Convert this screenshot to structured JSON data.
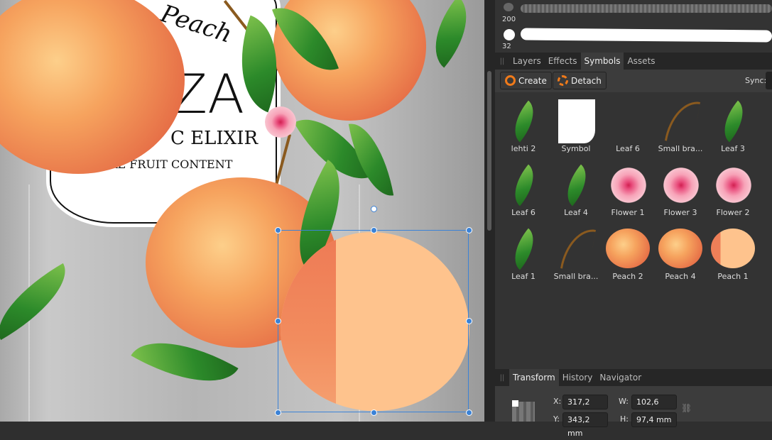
{
  "canvas": {
    "label": {
      "script": "Peach",
      "brand": "ZA",
      "line1": "C ELIXIR",
      "line2": "URE FRUIT CONTENT"
    }
  },
  "brushes": [
    {
      "size": "200"
    },
    {
      "size": "32"
    }
  ],
  "top_tabs": [
    {
      "label": "Layers"
    },
    {
      "label": "Effects"
    },
    {
      "label": "Symbols",
      "active": true
    },
    {
      "label": "Assets"
    }
  ],
  "symbols_toolbar": {
    "create": "Create",
    "detach": "Detach",
    "sync": "Sync:"
  },
  "symbols": [
    {
      "label": "lehti 2",
      "kind": "leaf"
    },
    {
      "label": "Symbol",
      "kind": "white"
    },
    {
      "label": "Leaf 6",
      "kind": "none"
    },
    {
      "label": "Small bra...",
      "kind": "branch"
    },
    {
      "label": "Leaf 3",
      "kind": "leaf"
    },
    {
      "label": "Leaf 6",
      "kind": "leaf"
    },
    {
      "label": "Leaf 4",
      "kind": "leaf"
    },
    {
      "label": "Flower 1",
      "kind": "flower"
    },
    {
      "label": "Flower 3",
      "kind": "flower"
    },
    {
      "label": "Flower 2",
      "kind": "flower"
    },
    {
      "label": "Leaf 1",
      "kind": "leaf"
    },
    {
      "label": "Small bra...",
      "kind": "branch"
    },
    {
      "label": "Peach 2",
      "kind": "peach"
    },
    {
      "label": "Peach 4",
      "kind": "peach"
    },
    {
      "label": "Peach 1",
      "kind": "flatpeach"
    }
  ],
  "bottom_tabs": [
    {
      "label": "Transform",
      "active": true
    },
    {
      "label": "History"
    },
    {
      "label": "Navigator"
    }
  ],
  "transform": {
    "x_label": "X:",
    "x": "317,2 mm",
    "y_label": "Y:",
    "y": "343,2 mm",
    "w_label": "W:",
    "w": "102,6 mm",
    "h_label": "H:",
    "h": "97,4 mm"
  },
  "colors": {
    "accent": "#f07a1a",
    "selection": "#3b82d6"
  }
}
